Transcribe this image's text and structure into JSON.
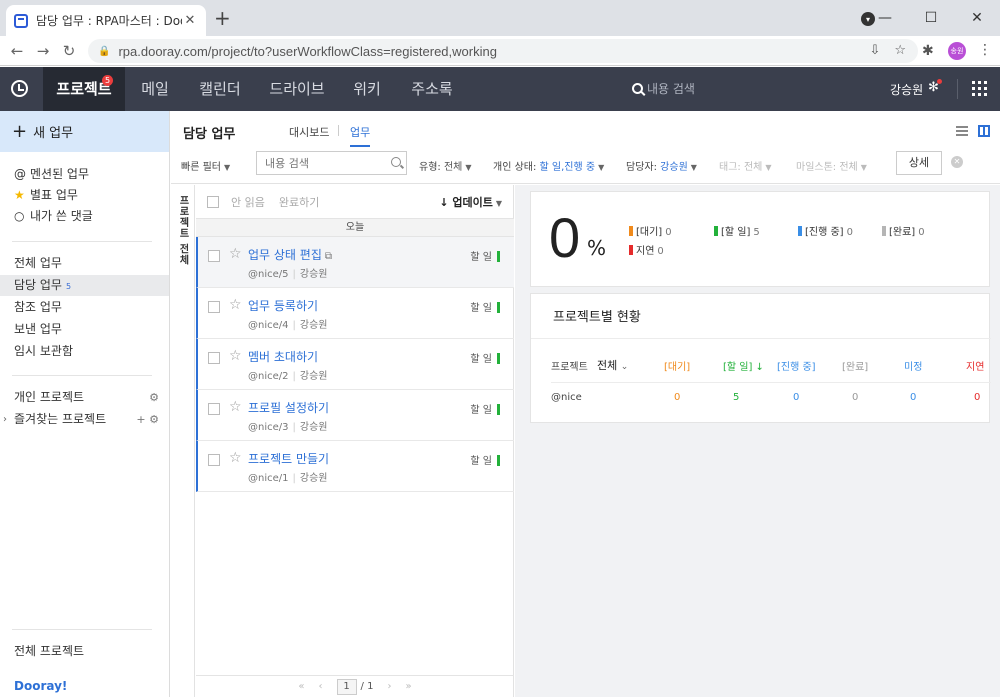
{
  "browser": {
    "tab_title": "담당 업무 : RPA마스터 : Dooray!",
    "url": "rpa.dooray.com/project/to?userWorkflowClass=registered,working",
    "profile_initials": "송원"
  },
  "appbar": {
    "nav": [
      {
        "label": "프로젝트",
        "badge": "5"
      },
      {
        "label": "메일"
      },
      {
        "label": "캘린더"
      },
      {
        "label": "드라이브"
      },
      {
        "label": "위키"
      },
      {
        "label": "주소록"
      }
    ],
    "search_placeholder": "내용 검색",
    "user_name": "강승원"
  },
  "sidebar": {
    "new_task": "새 업무",
    "group1": [
      {
        "icon": "@",
        "label": "멘션된 업무"
      },
      {
        "icon": "★",
        "label": "별표 업무"
      },
      {
        "icon": "○",
        "label": "내가 쓴 댓글"
      }
    ],
    "group2": [
      {
        "label": "전체 업무"
      },
      {
        "label": "담당 업무",
        "count": "5"
      },
      {
        "label": "참조 업무"
      },
      {
        "label": "보낸 업무"
      },
      {
        "label": "임시 보관함"
      }
    ],
    "personal_project": "개인 프로젝트",
    "favorite_project": "즐겨찾는 프로젝트",
    "all_projects": "전체 프로젝트",
    "logo": "Dooray!"
  },
  "header": {
    "title": "담당 업무",
    "tabs": [
      "대시보드",
      "업무"
    ],
    "active_tab": "업무"
  },
  "filters": {
    "quick_filter": "빠른 필터",
    "search_placeholder": "내용 검색",
    "type_label": "유형:",
    "type_value": "전체",
    "status_label": "개인 상태:",
    "status_value": "할 일,진행 중",
    "assignee_label": "담당자:",
    "assignee_value": "강승원",
    "tag_label": "태그:",
    "tag_value": "전체",
    "milestone_label": "마일스톤:",
    "milestone_value": "전체",
    "detail_btn": "상세"
  },
  "vertical_tab": "프로젝트 전체",
  "tasklist": {
    "unread": "안 읽음",
    "complete": "완료하기",
    "sort": "업데이트",
    "group_today": "오늘",
    "rows": [
      {
        "title": "업무 상태 편집",
        "id": "@nice/5",
        "owner": "강승원",
        "status": "할 일",
        "has_link": true
      },
      {
        "title": "업무 등록하기",
        "id": "@nice/4",
        "owner": "강승원",
        "status": "할 일"
      },
      {
        "title": "멤버 초대하기",
        "id": "@nice/2",
        "owner": "강승원",
        "status": "할 일"
      },
      {
        "title": "프로필 설정하기",
        "id": "@nice/3",
        "owner": "강승원",
        "status": "할 일"
      },
      {
        "title": "프로젝트 만들기",
        "id": "@nice/1",
        "owner": "강승원",
        "status": "할 일"
      }
    ],
    "pager": {
      "current": "1",
      "total": "/ 1"
    }
  },
  "stats": {
    "percent": "0",
    "percent_unit": "%",
    "items": [
      {
        "label": "[대기]",
        "value": "0",
        "color": "#f08a1c"
      },
      {
        "label": "[할 일]",
        "value": "5",
        "color": "#23b13b"
      },
      {
        "label": "[진행 중]",
        "value": "0",
        "color": "#3a8ee6"
      },
      {
        "label": "[완료]",
        "value": "0",
        "color": "#b5b5b5"
      },
      {
        "label": "지연",
        "value": "0",
        "color": "#e52b2b"
      }
    ]
  },
  "project_status": {
    "title": "프로젝트별 현황",
    "col_project": "프로젝트",
    "filter_all": "전체",
    "columns": [
      "[대기]",
      "[할 일] ↓",
      "[진행 중]",
      "[완료]",
      "미정",
      "지연"
    ],
    "row": {
      "name": "@nice",
      "values": [
        "0",
        "5",
        "0",
        "0",
        "0",
        "0"
      ]
    }
  }
}
